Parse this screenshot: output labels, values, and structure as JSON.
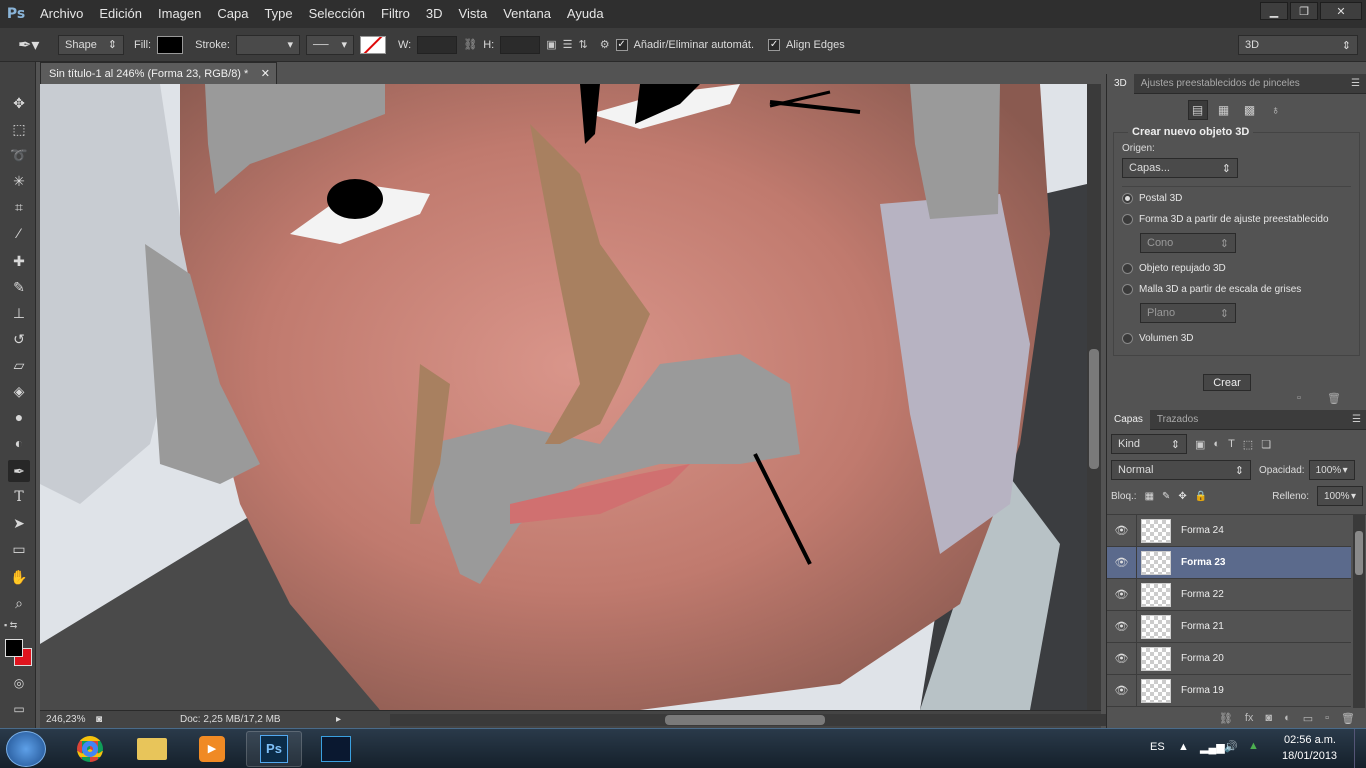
{
  "app": {
    "logo": "Ps"
  },
  "menu": [
    "Archivo",
    "Edición",
    "Imagen",
    "Capa",
    "Type",
    "Selección",
    "Filtro",
    "3D",
    "Vista",
    "Ventana",
    "Ayuda"
  ],
  "window_buttons": {
    "minimize": "▁",
    "restore": "❐",
    "close": "✕"
  },
  "options": {
    "mode": "Shape",
    "fill_label": "Fill:",
    "stroke_label": "Stroke:",
    "w_label": "W:",
    "h_label": "H:",
    "auto_add_label": "Añadir/Eliminar automát.",
    "align_edges_label": "Align Edges",
    "workspace": "3D",
    "fill_color": "#000000"
  },
  "document": {
    "tab_title": "Sin título-1 al 246% (Forma 23, RGB/8) *",
    "tab_close": "✕",
    "zoom": "246,23%",
    "doc_info": "Doc: 2,25 MB/17,2 MB"
  },
  "panel_3d": {
    "tabs": [
      "3D",
      "Ajustes preestablecidos de pinceles"
    ],
    "group_title": "Crear nuevo objeto 3D",
    "source_label": "Origen:",
    "source_value": "Capas...",
    "options": [
      {
        "label": "Postal 3D",
        "selected": true
      },
      {
        "label": "Forma 3D a partir de ajuste preestablecido",
        "selected": false
      },
      {
        "label": "Objeto repujado 3D",
        "selected": false
      },
      {
        "label": "Malla 3D a partir de escala de grises",
        "selected": false
      },
      {
        "label": "Volumen 3D",
        "selected": false
      }
    ],
    "preset_value": "Cono",
    "mesh_value": "Plano",
    "create_button": "Crear"
  },
  "layers_panel": {
    "tabs": [
      "Capas",
      "Trazados"
    ],
    "filter": "Kind",
    "blend_mode": "Normal",
    "opacity_label": "Opacidad:",
    "opacity_value": "100%",
    "lock_label": "Bloq.:",
    "fill_label": "Relleno:",
    "fill_value": "100%",
    "layers": [
      {
        "name": "Forma 24",
        "selected": false
      },
      {
        "name": "Forma 23",
        "selected": true
      },
      {
        "name": "Forma 22",
        "selected": false
      },
      {
        "name": "Forma 21",
        "selected": false
      },
      {
        "name": "Forma 20",
        "selected": false
      },
      {
        "name": "Forma 19",
        "selected": false
      }
    ]
  },
  "taskbar": {
    "language": "ES",
    "time": "02:56 a.m.",
    "date": "18/01/2013",
    "ps_label": "Ps"
  },
  "colors": {
    "accent_selected_layer": "#5b6a8c",
    "foreground": "#000000",
    "background_swatch": "#e0141e"
  }
}
